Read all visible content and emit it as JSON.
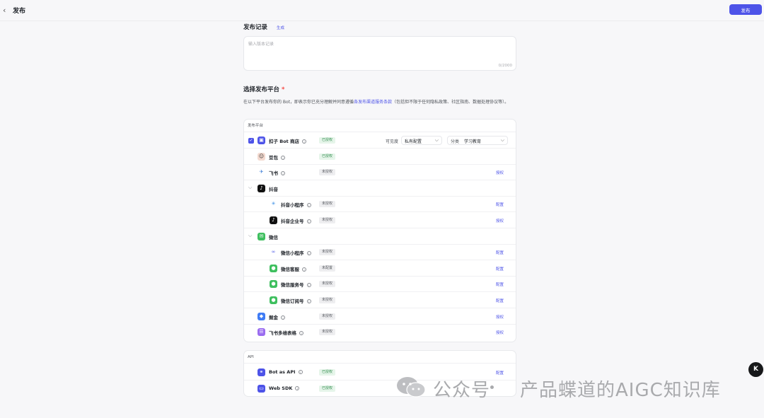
{
  "header": {
    "back_icon": "chevron-left-icon",
    "title": "发布",
    "publish_label": "发布"
  },
  "record": {
    "title": "发布记录",
    "generate_label": "生成",
    "placeholder": "输入版本记录",
    "counter": "0/2000"
  },
  "platform": {
    "title": "选择发布平台",
    "required_mark": "*",
    "desc_before": "在以下平台发布你的 Bot，即表示你已充分理解并同意遵循",
    "desc_link": "各发布渠道服务条款",
    "desc_after": "（包括但不限于任何隐私政策、社区指南、数据处理协议等）。",
    "card_head": "发布平台",
    "visibility_label": "可见度",
    "visibility_value": "私有配置",
    "category_label": "分类",
    "category_value": "学习教育",
    "rows": [
      {
        "name": "扣子 Bot 商店",
        "status": "已授权",
        "icon": "coze-store-icon",
        "checked": true
      },
      {
        "name": "豆包",
        "status": "已授权",
        "icon": "doubao-icon"
      },
      {
        "name": "飞书",
        "status": "未授权",
        "action": "授权",
        "icon": "feishu-icon"
      },
      {
        "name": "抖音",
        "icon": "douyin-icon",
        "group": true
      },
      {
        "name": "抖音小程序",
        "status": "未授权",
        "action": "配置",
        "icon": "douyin-miniapp-icon"
      },
      {
        "name": "抖音企业号",
        "status": "未授权",
        "action": "授权",
        "icon": "douyin-enterprise-icon"
      },
      {
        "name": "微信",
        "icon": "wechat-icon",
        "group": true
      },
      {
        "name": "微信小程序",
        "status": "未授权",
        "action": "配置",
        "icon": "wechat-miniapp-icon"
      },
      {
        "name": "微信客服",
        "status": "未配置",
        "action": "配置",
        "icon": "wechat-service-icon"
      },
      {
        "name": "微信服务号",
        "status": "未授权",
        "action": "配置",
        "icon": "wechat-official-icon"
      },
      {
        "name": "微信订阅号",
        "status": "未授权",
        "action": "配置",
        "icon": "wechat-subscription-icon"
      },
      {
        "name": "掘金",
        "status": "未授权",
        "action": "授权",
        "icon": "juejin-icon"
      },
      {
        "name": "飞书多维表格",
        "status": "未授权",
        "action": "授权",
        "icon": "feishu-bitable-icon"
      }
    ]
  },
  "api": {
    "card_head": "API",
    "rows": [
      {
        "name": "Bot as API",
        "status": "已授权",
        "action": "配置",
        "icon": "api-link-icon"
      },
      {
        "name": "Web SDK",
        "status": "已授权",
        "icon": "web-sdk-icon"
      }
    ]
  },
  "watermark": {
    "text_left": "公众号",
    "text_right": "产品蝶道的AIGC知识库"
  },
  "fab": {
    "label": "K"
  },
  "colors": {
    "accent": "#4d53e8",
    "authorized_bg": "#e6f5ea",
    "authorized_text": "#2e8b4b"
  }
}
